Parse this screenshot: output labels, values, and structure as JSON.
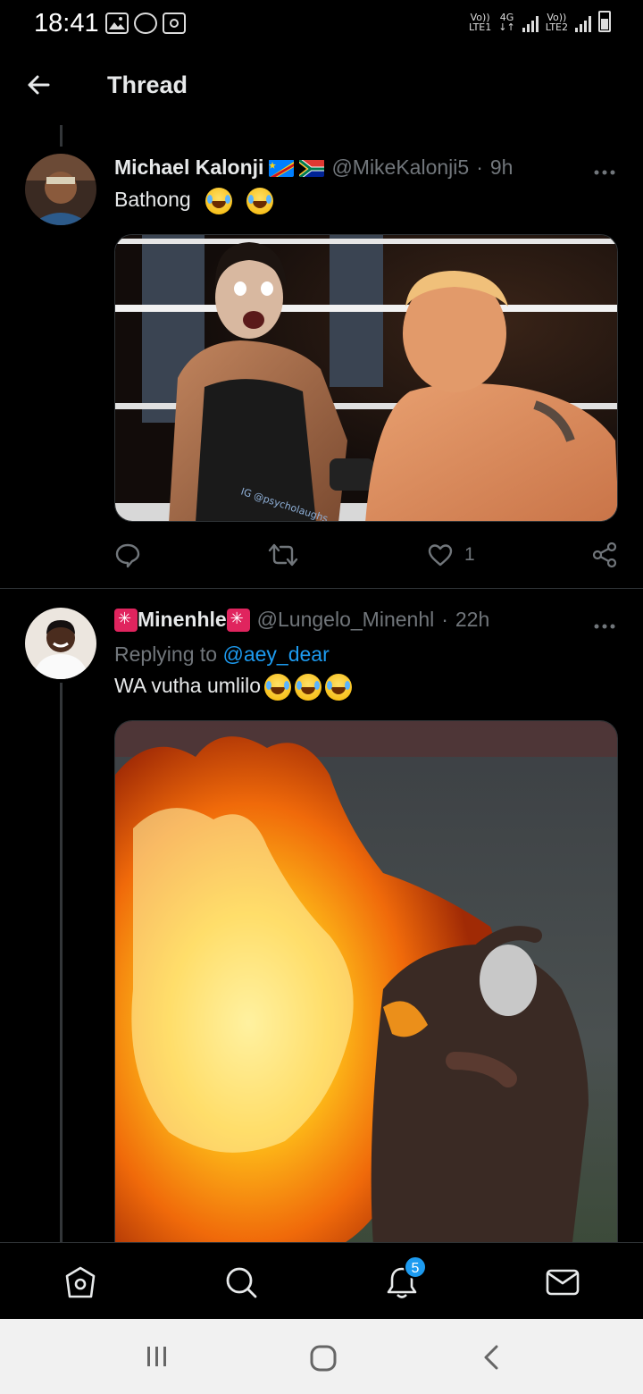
{
  "status_bar": {
    "time": "18:41",
    "sim1_line1": "Vo))",
    "sim1_line2": "LTE1",
    "net_type": "4G",
    "sim2_line1": "Vo))",
    "sim2_line2": "LTE2",
    "icons": [
      "gallery-icon",
      "shield-icon",
      "screen-recorder-icon",
      "signal-icon",
      "battery-icon"
    ]
  },
  "header": {
    "title": "Thread"
  },
  "tweets": [
    {
      "display_name": "Michael Kalonji",
      "flags": [
        "flag-dr-congo",
        "flag-south-africa"
      ],
      "handle": "@MikeKalonji5",
      "separator": "·",
      "time": "9h",
      "text": "Bathong",
      "emojis": [
        "face-with-tears-of-joy",
        "face-with-tears-of-joy"
      ],
      "media_watermark": "IG @psycholaughs",
      "reply_count": "",
      "retweet_count": "",
      "like_count": "1"
    },
    {
      "display_name": "Minenhle",
      "handle": "@Lungelo_Minenhl",
      "separator": "·",
      "time": "22h",
      "replying_prefix": "Replying to",
      "replying_mention": "@aey_dear",
      "text": "WA vutha umlilo",
      "emojis": [
        "face-with-tears-of-joy",
        "face-with-tears-of-joy",
        "face-with-tears-of-joy"
      ]
    }
  ],
  "bottom_nav": {
    "items": [
      "home-icon",
      "search-icon",
      "notifications-icon",
      "messages-icon"
    ],
    "notification_badge": "5"
  },
  "colors": {
    "background": "#000000",
    "accent": "#1d9bf0",
    "secondary_text": "#71767b",
    "divider": "#2f3336"
  }
}
